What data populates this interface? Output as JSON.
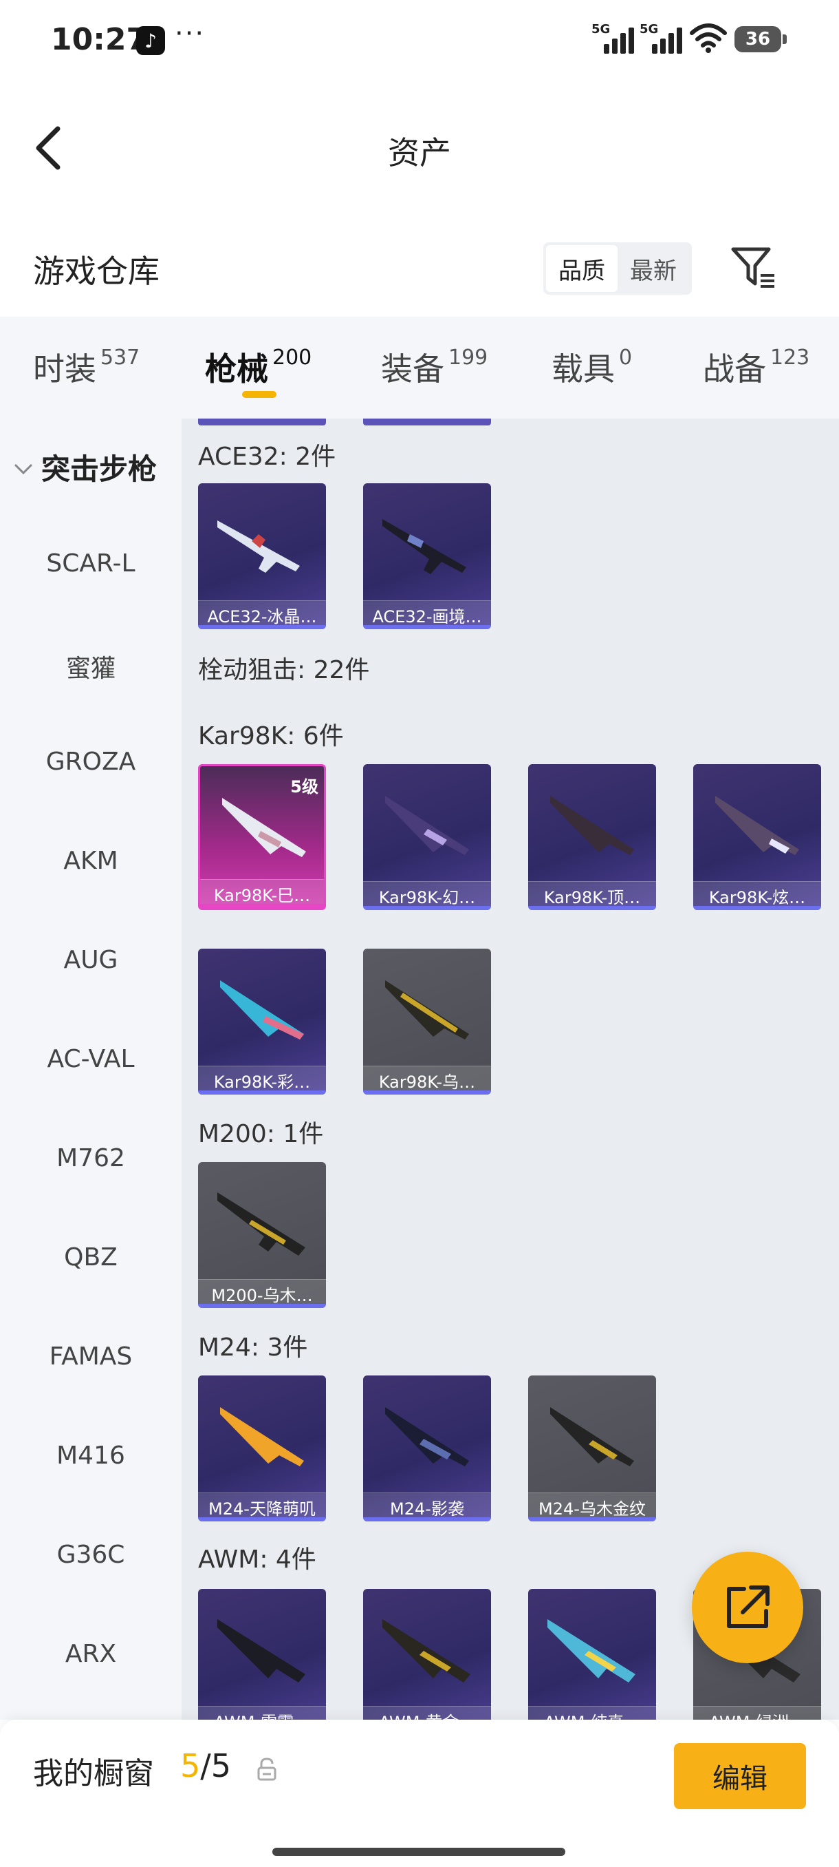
{
  "status_bar": {
    "time": "10:27",
    "tiktok_glyph": "♪",
    "more": "···",
    "signal_1_label": "5G",
    "signal_2_label": "5G",
    "battery": "36"
  },
  "nav": {
    "title": "资产",
    "back_icon": "chevron-left-icon"
  },
  "section": {
    "title": "游戏仓库",
    "sort_options": [
      "品质",
      "最新"
    ],
    "sort_selected": "品质",
    "filter_icon": "filter-icon"
  },
  "tabs": [
    {
      "label": "时装",
      "count": "537"
    },
    {
      "label": "枪械",
      "count": "200",
      "active": true
    },
    {
      "label": "装备",
      "count": "199"
    },
    {
      "label": "载具",
      "count": "0"
    },
    {
      "label": "战备",
      "count": "123"
    }
  ],
  "sidebar": {
    "group": "突击步枪",
    "items": [
      "SCAR-L",
      "蜜獾",
      "GROZA",
      "AKM",
      "AUG",
      "AC-VAL",
      "M762",
      "QBZ",
      "FAMAS",
      "M416",
      "G36C",
      "ARX"
    ]
  },
  "groups": {
    "ace32": {
      "title": "ACE32: 2件",
      "items": [
        "ACE32-冰晶…",
        "ACE32-画境…"
      ]
    },
    "bolt": {
      "title": "栓动狙击: 22件"
    },
    "kar98k": {
      "title": "Kar98K: 6件",
      "level_badge": "5级",
      "items": [
        "Kar98K-巳…",
        "Kar98K-幻…",
        "Kar98K-顶…",
        "Kar98K-炫…",
        "Kar98K-彩…",
        "Kar98K-乌…"
      ]
    },
    "m200": {
      "title": "M200: 1件",
      "items": [
        "M200-乌木…"
      ]
    },
    "m24": {
      "title": "M24: 3件",
      "items": [
        "M24-天降萌叽",
        "M24-影袭",
        "M24-乌木金纹"
      ]
    },
    "awm": {
      "title": "AWM: 4件",
      "items": [
        "AWM-雷霆…",
        "AWM-黄金…",
        "AWM-纯真…",
        "AWM-绿洲…"
      ]
    }
  },
  "bottom_bar": {
    "title": "我的橱窗",
    "used": "5",
    "sep_total": "/5",
    "edit_label": "编辑"
  },
  "colors": {
    "accent": "#f7b016",
    "highlight": "#f5b400",
    "rare_pink": "#e646c6",
    "card_purple": "#2f2a66"
  }
}
